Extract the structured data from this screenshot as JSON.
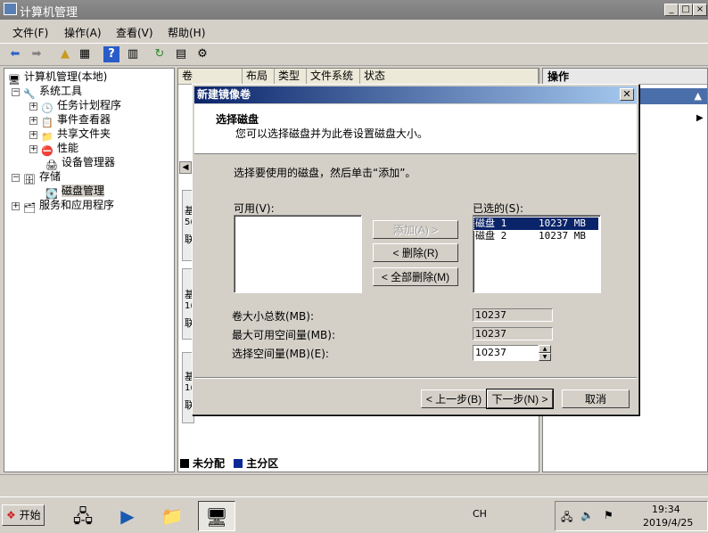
{
  "window": {
    "title": "计算机管理"
  },
  "menu": [
    "文件(F)",
    "操作(A)",
    "查看(V)",
    "帮助(H)"
  ],
  "tree": {
    "root": "计算机管理(本地)",
    "system_tools": "系统工具",
    "task_scheduler": "任务计划程序",
    "event_viewer": "事件查看器",
    "shared_folders": "共享文件夹",
    "performance": "性能",
    "device_manager": "设备管理器",
    "storage": "存储",
    "disk_management": "磁盘管理",
    "services_apps": "服务和应用程序"
  },
  "middle": {
    "columns": [
      "卷",
      "布局",
      "类型",
      "文件系统",
      "状态"
    ],
    "disk_rows": [
      {
        "line1": "基",
        "line2": "5(",
        "line3": "联"
      },
      {
        "line1": "基",
        "line2": "1(",
        "line3": "联"
      },
      {
        "line1": "基",
        "line2": "1(",
        "line3": "联"
      }
    ],
    "legend_unallocated": "未分配",
    "legend_primary": "主分区"
  },
  "right": {
    "header": "操作"
  },
  "dialog": {
    "title": "新建镜像卷",
    "heading": "选择磁盘",
    "subheading": "您可以选择磁盘并为此卷设置磁盘大小。",
    "instruction": "选择要使用的磁盘，然后单击“添加”。",
    "available_label": "可用(V):",
    "selected_label": "已选的(S):",
    "add_button": "添加(A) >",
    "remove_button": "< 删除(R)",
    "remove_all_button": "< 全部删除(M)",
    "selected_disks": [
      {
        "name": "磁盘 1",
        "size": "10237 MB"
      },
      {
        "name": "磁盘 2",
        "size": "10237 MB"
      }
    ],
    "total_label": "卷大小总数(MB):",
    "total_value": "10237",
    "max_label": "最大可用空间量(MB):",
    "max_value": "10237",
    "select_label": "选择空间量(MB)(E):",
    "select_value": "10237",
    "back_button": "< 上一步(B)",
    "next_button": "下一步(N) >",
    "cancel_button": "取消"
  },
  "taskbar": {
    "start": "开始",
    "tray_lang": "CH",
    "time": "19:34",
    "date": "2019/4/25"
  },
  "colors": {
    "dialog_title": "#0a246a",
    "selection": "#0a246a",
    "unallocated": "#000000",
    "primary": "#0a2896"
  }
}
